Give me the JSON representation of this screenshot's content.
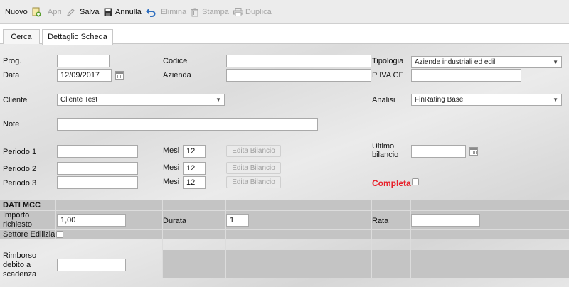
{
  "toolbar": {
    "nuovo": "Nuovo",
    "apri": "Apri",
    "salva": "Salva",
    "annulla": "Annulla",
    "elimina": "Elimina",
    "stampa": "Stampa",
    "duplica": "Duplica"
  },
  "tabs": [
    "Cerca",
    "Dettaglio Scheda"
  ],
  "labels": {
    "prog": "Prog.",
    "data": "Data",
    "codice": "Codice",
    "azienda": "Azienda",
    "tipologia": "Tipologia",
    "piva": "P IVA CF",
    "cliente": "Cliente",
    "analisi": "Analisi",
    "note": "Note",
    "periodo1": "Periodo 1",
    "periodo2": "Periodo 2",
    "periodo3": "Periodo 3",
    "mesi": "Mesi",
    "edita_bilancio": "Edita Bilancio",
    "ultimo_bilancio_1": "Ultimo",
    "ultimo_bilancio_2": "bilancio",
    "completa": "Completa"
  },
  "fields": {
    "prog": "",
    "data": "12/09/2017",
    "codice": "",
    "azienda": "",
    "tipologia": "Aziende industriali ed edili",
    "piva": "",
    "cliente": "Cliente Test",
    "analisi": "FinRating Base",
    "note": "",
    "periodo1": "",
    "periodo2": "",
    "periodo3": "",
    "mesi1": "12",
    "mesi2": "12",
    "mesi3": "12",
    "ultimo_bilancio": ""
  },
  "mcc": {
    "title": "DATI MCC",
    "importo_label_1": "Importo",
    "importo_label_2": "richiesto",
    "importo_value": "1,00",
    "durata_label": "Durata",
    "durata_value": "1",
    "rata_label": "Rata",
    "rata_value": "",
    "settore_label": "Settore Edilizia",
    "rimborso_label_1": "Rimborso",
    "rimborso_label_2": "debito a",
    "rimborso_label_3": "scadenza",
    "rimborso_value": ""
  },
  "icons": {
    "nuovo": "add-document-icon",
    "apri": "pencil-icon",
    "salva": "floppy-disk-icon",
    "annulla": "undo-arrow-icon",
    "elimina": "trash-icon",
    "stampa": "printer-icon",
    "calendar": "calendar-icon",
    "dropdown": "chevron-down-icon"
  },
  "colors": {
    "completa": "#e8202a",
    "undo": "#2f6fc0",
    "nuovo_icon": "#5a9e2f"
  }
}
